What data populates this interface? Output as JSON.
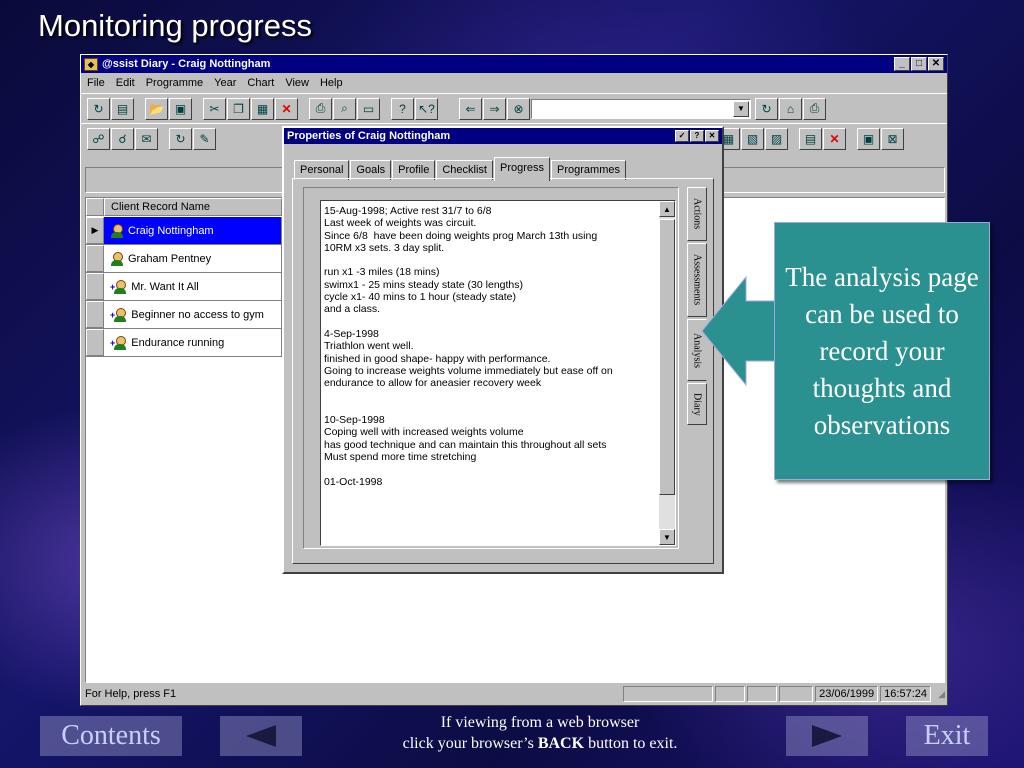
{
  "slide_title": "Monitoring progress",
  "app": {
    "title": "@ssist Diary - Craig Nottingham",
    "menu": [
      "File",
      "Edit",
      "Programme",
      "Year",
      "Chart",
      "View",
      "Help"
    ]
  },
  "client_list": {
    "column_header": "Client Record Name",
    "rows": [
      {
        "name": "Craig Nottingham",
        "selected": true
      },
      {
        "name": "Graham Pentney",
        "selected": false
      },
      {
        "name": "Mr. Want It All",
        "selected": false
      },
      {
        "name": "Beginner no access to gym",
        "selected": false
      },
      {
        "name": "Endurance running",
        "selected": false
      }
    ]
  },
  "status_bar": {
    "help": "For Help, press F1",
    "date": "23/06/1999",
    "time": "16:57:24"
  },
  "dialog": {
    "title": "Properties of Craig Nottingham",
    "tabs": [
      "Personal",
      "Goals",
      "Profile",
      "Checklist",
      "Progress",
      "Programmes"
    ],
    "active_tab": "Progress",
    "side_tabs": [
      "Actions",
      "Assessments",
      "Analysis",
      "Diary"
    ],
    "active_side_tab": "Analysis",
    "memo_text": "15-Aug-1998; Active rest 31/7 to 6/8\nLast week of weights was circuit.\nSince 6/8  have been doing weights prog March 13th using\n10RM x3 sets. 3 day split.\n\nrun x1 -3 miles (18 mins)\nswimx1 - 25 mins steady state (30 lengths)\ncycle x1- 40 mins to 1 hour (steady state)\nand a class.\n\n4-Sep-1998\nTriathlon went well.\nfinished in good shape- happy with performance.\nGoing to increase weights volume immediately but ease off on\nendurance to allow for aneasier recovery week\n\n\n10-Sep-1998\nCoping well with increased weights volume\nhas good technique and can maintain this throughout all sets\nMust spend more time stretching\n\n01-Oct-1998"
  },
  "callout": {
    "text": "The analysis page can be used to record your thoughts and observations",
    "color": "#2a9090"
  },
  "footer": {
    "contents": "Contents",
    "exit": "Exit",
    "note_line1": "If viewing from a web browser",
    "note_line2_pre": "click your browser’s ",
    "note_back": "BACK",
    "note_line2_post": " button to exit."
  }
}
